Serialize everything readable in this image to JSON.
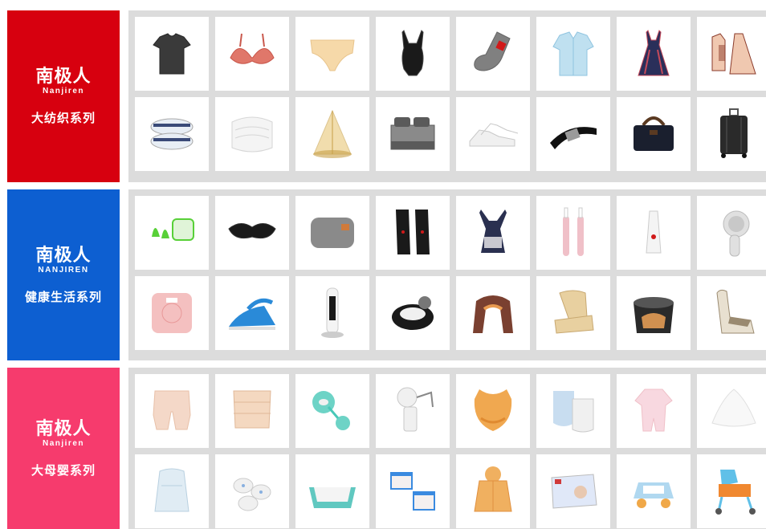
{
  "colors": {
    "grid_bg": "#dcdcdc",
    "card_bg": "#ffffff"
  },
  "sections": [
    {
      "color": "#d7000f",
      "brand_cn": "南极人",
      "brand_en": "Nanjiren",
      "series": "大纺织系列",
      "products": [
        {
          "icon": "tshirt-icon",
          "c1": "#3a3a3a",
          "c2": "#262626"
        },
        {
          "icon": "bra-icon",
          "c1": "#e0776a",
          "c2": "#c9584c"
        },
        {
          "icon": "underwear-icon",
          "c1": "#f6d9a9",
          "c2": "#e8c48c"
        },
        {
          "icon": "shapewear-icon",
          "c1": "#1a1a1a",
          "c2": "#444444"
        },
        {
          "icon": "sock-icon",
          "c1": "#808080",
          "c2": "#d11a1a"
        },
        {
          "icon": "shirt-icon",
          "c1": "#bfe0f0",
          "c2": "#8fc4e0"
        },
        {
          "icon": "dress-icon",
          "c1": "#2a2f5a",
          "c2": "#c54a5a"
        },
        {
          "icon": "pajamas-icon",
          "c1": "#f0c8b0",
          "c2": "#8a3a2a"
        },
        {
          "icon": "pillow-icon",
          "c1": "#e8eef5",
          "c2": "#3a4a78"
        },
        {
          "icon": "duvet-icon",
          "c1": "#f4f4f4",
          "c2": "#d6d6d6"
        },
        {
          "icon": "mosquito-net-icon",
          "c1": "#e8c878",
          "c2": "#c8a048"
        },
        {
          "icon": "bedding-set-icon",
          "c1": "#8a8a8a",
          "c2": "#5a5a5a"
        },
        {
          "icon": "sneaker-icon",
          "c1": "#f0f0f0",
          "c2": "#c8c8c8"
        },
        {
          "icon": "belt-icon",
          "c1": "#111111",
          "c2": "#9a9a9a"
        },
        {
          "icon": "handbag-icon",
          "c1": "#1a1f2e",
          "c2": "#5a3a22"
        },
        {
          "icon": "suitcase-icon",
          "c1": "#2a2a2a",
          "c2": "#555555"
        }
      ]
    },
    {
      "color": "#0d5fd1",
      "brand_cn": "南极人",
      "brand_en": "NANJIREN",
      "series": "健康生活系列",
      "products": [
        {
          "icon": "earplugs-icon",
          "c1": "#58d038",
          "c2": "#e0f4d8"
        },
        {
          "icon": "eye-mask-icon",
          "c1": "#1a1a1a",
          "c2": "#333333"
        },
        {
          "icon": "heating-pad-icon",
          "c1": "#8a8a8a",
          "c2": "#d07a3a"
        },
        {
          "icon": "knee-brace-icon",
          "c1": "#1a1a1a",
          "c2": "#d01a1a"
        },
        {
          "icon": "posture-corrector-icon",
          "c1": "#2a3050",
          "c2": "#c8c8d0"
        },
        {
          "icon": "electric-toothbrush-icon",
          "c1": "#f0c0c8",
          "c2": "#ffffff"
        },
        {
          "icon": "pore-cleaner-icon",
          "c1": "#f4f4f4",
          "c2": "#d01a1a"
        },
        {
          "icon": "face-brush-icon",
          "c1": "#e0e0e0",
          "c2": "#c8c8c8"
        },
        {
          "icon": "body-scale-icon",
          "c1": "#f4c0c0",
          "c2": "#e89898"
        },
        {
          "icon": "steam-iron-icon",
          "c1": "#2a8ad8",
          "c2": "#e0e0e0"
        },
        {
          "icon": "tower-fan-icon",
          "c1": "#f4f4f4",
          "c2": "#1a1a1a"
        },
        {
          "icon": "leg-massager-icon",
          "c1": "#1a1a1a",
          "c2": "#f0f0f0"
        },
        {
          "icon": "neck-massager-icon",
          "c1": "#7a4030",
          "c2": "#e89a50"
        },
        {
          "icon": "lumbar-cushion-icon",
          "c1": "#e8d0a0",
          "c2": "#c8a870"
        },
        {
          "icon": "foot-bath-icon",
          "c1": "#2a2a2a",
          "c2": "#d09050"
        },
        {
          "icon": "massage-chair-icon",
          "c1": "#e8e0d0",
          "c2": "#9a8a70"
        }
      ]
    },
    {
      "color": "#f63b6d",
      "brand_cn": "南极人",
      "brand_en": "Nanjiren",
      "series": "大母婴系列",
      "products": [
        {
          "icon": "maternity-shorts-icon",
          "c1": "#f4d8c8",
          "c2": "#e8c0a8"
        },
        {
          "icon": "postpartum-belt-icon",
          "c1": "#f4d8c0",
          "c2": "#e0b898"
        },
        {
          "icon": "pacifier-icon",
          "c1": "#48c8b8",
          "c2": "#f0f0f0"
        },
        {
          "icon": "breast-pump-icon",
          "c1": "#f0f0f0",
          "c2": "#c8c8c8"
        },
        {
          "icon": "baby-bib-icon",
          "c1": "#f0a850",
          "c2": "#e08a30"
        },
        {
          "icon": "bib-set-icon",
          "c1": "#c8ddf0",
          "c2": "#f0f0f0"
        },
        {
          "icon": "baby-romper-icon",
          "c1": "#f8d8e0",
          "c2": "#f0c0c8"
        },
        {
          "icon": "baby-hat-icon",
          "c1": "#f8f8f8",
          "c2": "#e0e0e0"
        },
        {
          "icon": "swaddle-icon",
          "c1": "#e0ecf4",
          "c2": "#b8d0e0"
        },
        {
          "icon": "baby-socks-icon",
          "c1": "#f0f0f0",
          "c2": "#88b0e0"
        },
        {
          "icon": "baby-bathtub-icon",
          "c1": "#60c8c0",
          "c2": "#f4f4f4"
        },
        {
          "icon": "kids-underwear-icon",
          "c1": "#3a8ae0",
          "c2": "#f4f0f0"
        },
        {
          "icon": "kids-jacket-icon",
          "c1": "#f0b060",
          "c2": "#e09040"
        },
        {
          "icon": "diapers-icon",
          "c1": "#e0e8f8",
          "c2": "#d03a3a"
        },
        {
          "icon": "toy-car-icon",
          "c1": "#b0d8f0",
          "c2": "#f0a848"
        },
        {
          "icon": "baby-walker-icon",
          "c1": "#60c0e8",
          "c2": "#f08830"
        }
      ]
    }
  ]
}
